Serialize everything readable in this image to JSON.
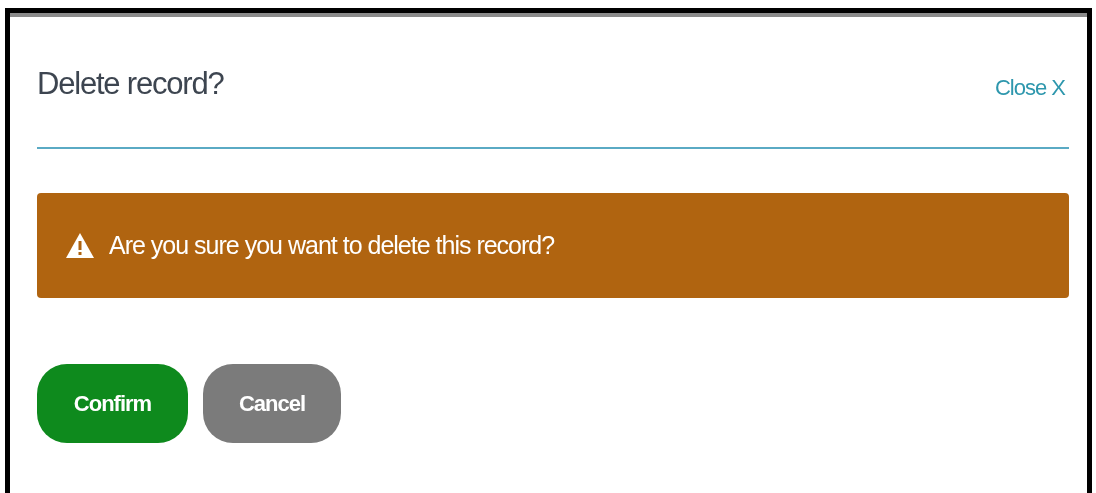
{
  "dialog": {
    "title": "Delete record?",
    "close_label": "Close X"
  },
  "alert": {
    "message": "Are you sure you want to delete this record?"
  },
  "buttons": [
    {
      "label": "Confirm",
      "kind": "primary"
    },
    {
      "label": "Cancel",
      "kind": "secondary"
    }
  ]
}
